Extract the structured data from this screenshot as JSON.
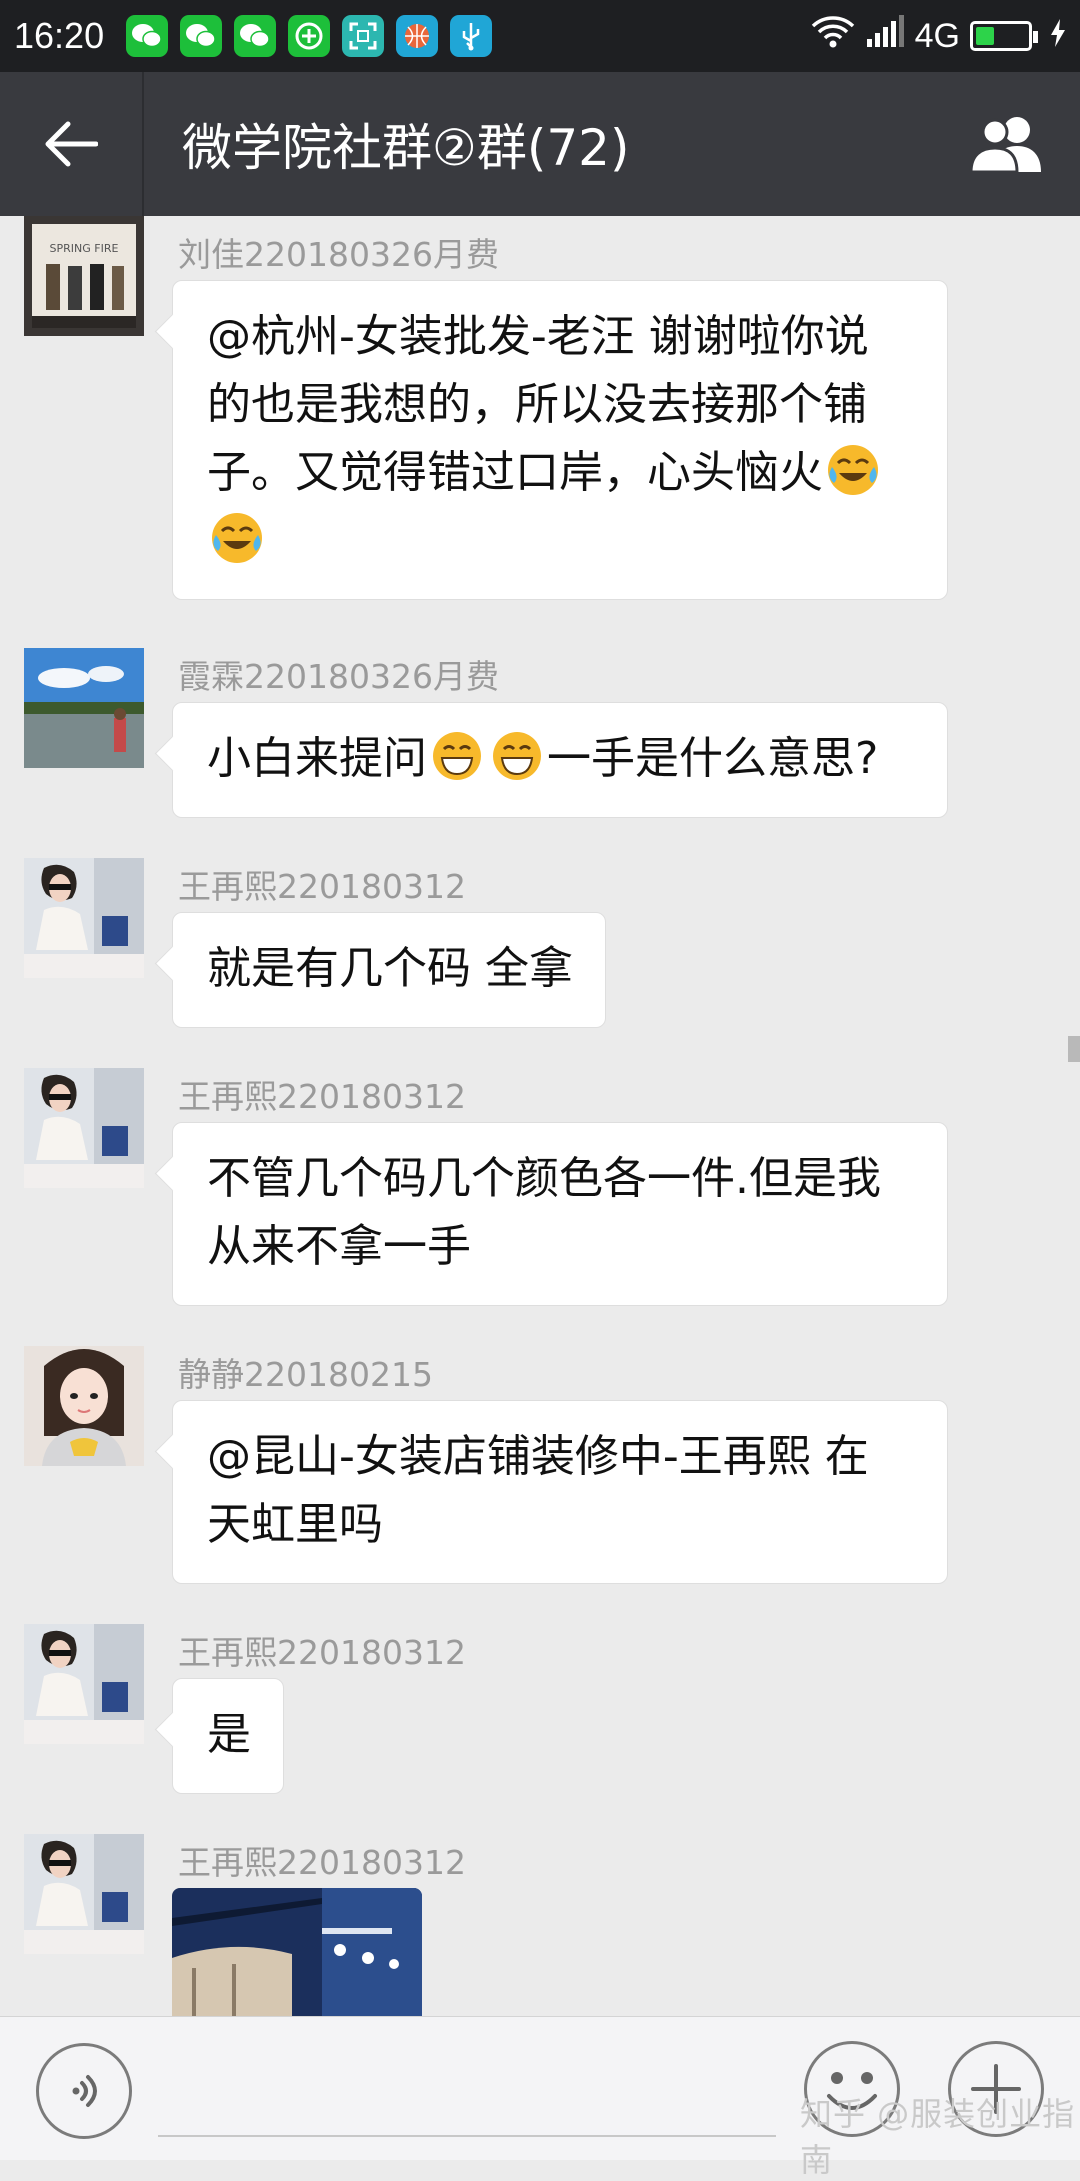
{
  "status_bar": {
    "time": "16:20",
    "notification_icons": [
      "wechat-icon",
      "wechat-icon",
      "wechat-icon",
      "plus-app-icon",
      "scan-icon",
      "basketball-icon",
      "usb-icon"
    ],
    "network": "4G",
    "battery_percent": 35
  },
  "header": {
    "title": "微学院社群②群(72)"
  },
  "messages": [
    {
      "sender": "刘佳220180326月费",
      "text_lines": [
        "@杭州-女装批发-老汪  谢谢啦你说",
        "的也是我想的，所以没去接那个铺",
        "子。又觉得错过口岸，心头恼火"
      ]
    },
    {
      "sender": "霞霖220180326月费",
      "text_parts": [
        "小白来提问",
        "一手是什么意思?"
      ]
    },
    {
      "sender": "王再熙220180312",
      "text": "就是有几个码 全拿"
    },
    {
      "sender": "王再熙220180312",
      "text_lines": [
        "不管几个码几个颜色各一件.但是我",
        "从来不拿一手"
      ]
    },
    {
      "sender": "静静220180215",
      "text_lines": [
        "@昆山-女装店铺装修中-王再熙  在",
        "天虹里吗"
      ]
    },
    {
      "sender": "王再熙220180312",
      "text": "是"
    },
    {
      "sender": "王再熙220180312",
      "image": "store-photo"
    }
  ],
  "avatar_image": {
    "sign_text": "SPRING FIRE"
  },
  "watermark": "知乎 @服装创业指南",
  "colors": {
    "status_bar": "#1e1f22",
    "title_bar": "#393a3f",
    "chat_bg": "#ebebeb",
    "bubble": "#ffffff",
    "battery": "#2dd34a"
  }
}
